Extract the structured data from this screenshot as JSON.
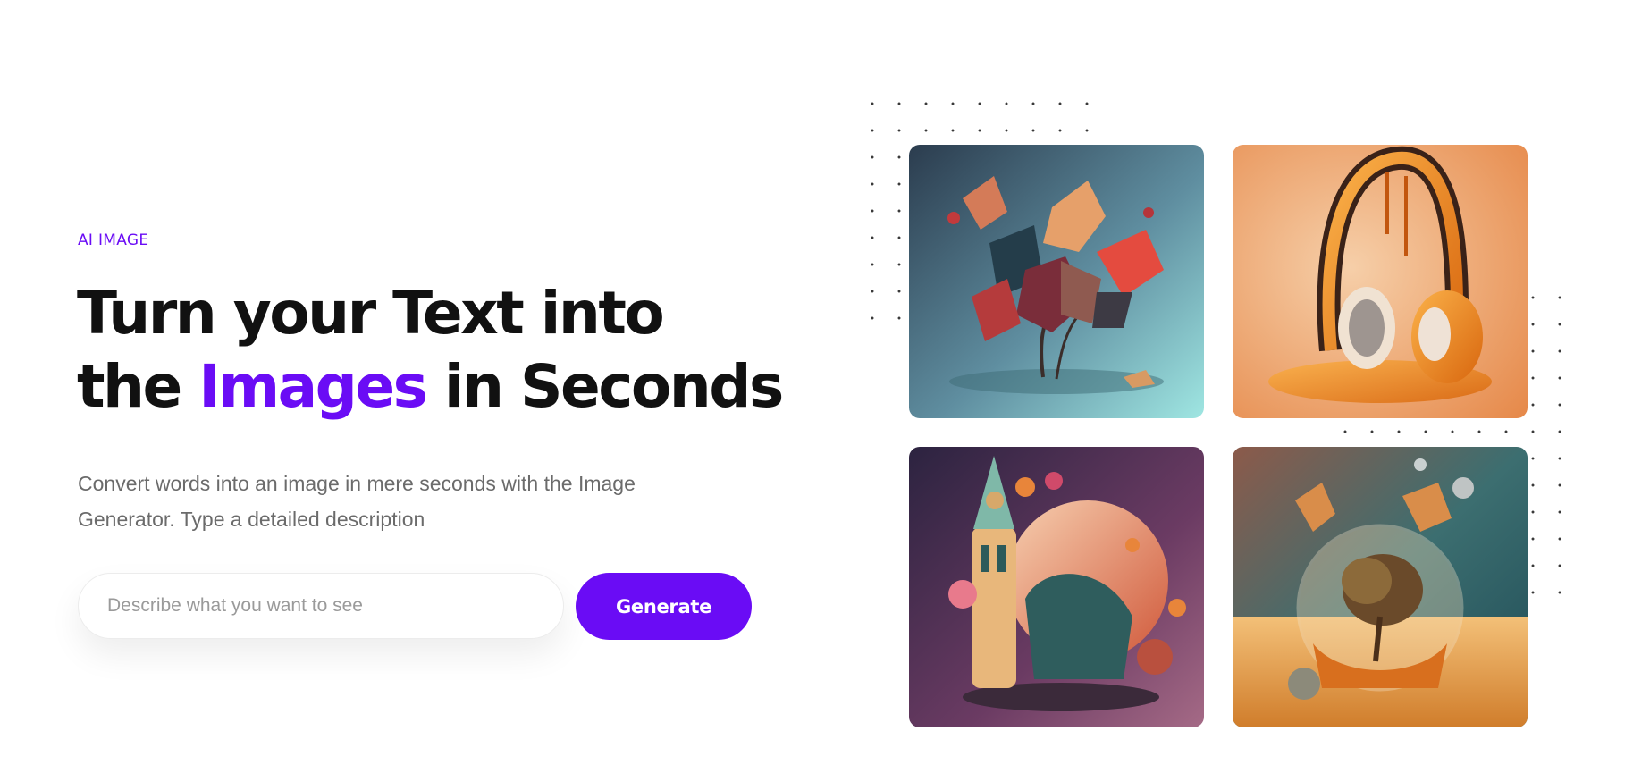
{
  "hero": {
    "eyebrow": "AI IMAGE",
    "headline": {
      "line1": "Turn your Text into",
      "line2_before": "the ",
      "line2_accent": "Images",
      "line2_after": " in Seconds"
    },
    "subtitle": "Convert words into an image in mere seconds with the Image Generator. Type a detailed description",
    "prompt": {
      "placeholder": "Describe what you want to see",
      "value": ""
    },
    "generate_label": "Generate"
  },
  "colors": {
    "accent": "#6a0cf5",
    "heading": "#111111",
    "body": "#6b6b6b"
  },
  "gallery": [
    {
      "name": "autumn-leaves-bouquet",
      "icon": "autumn-leaves-image"
    },
    {
      "name": "melting-headphones",
      "icon": "melting-headphones-image"
    },
    {
      "name": "fantasy-castle-balloons",
      "icon": "fantasy-castle-image"
    },
    {
      "name": "desert-tree-globe",
      "icon": "desert-globe-image"
    }
  ]
}
